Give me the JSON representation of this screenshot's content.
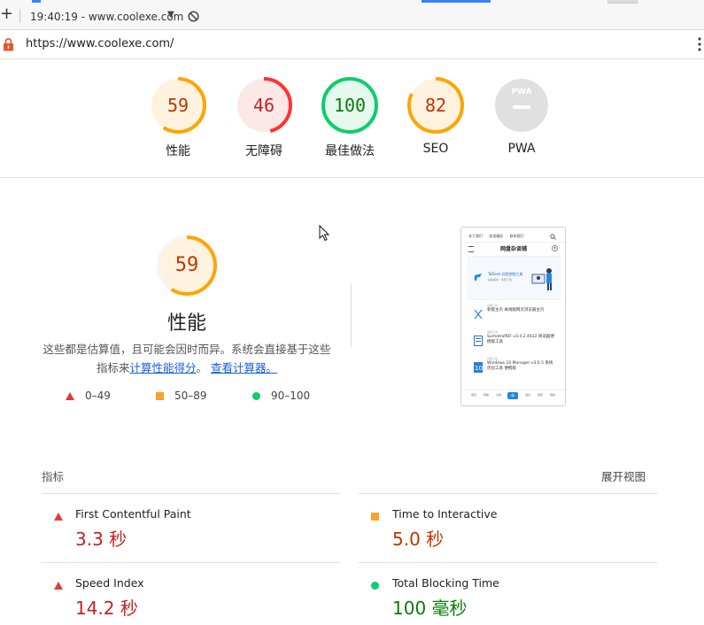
{
  "browser": {
    "tab_time_url": "19:40:19 - www.coolexe.com",
    "address": "https://www.coolexe.com/"
  },
  "categories": [
    {
      "label": "性能",
      "score": "59",
      "fraction": 0.59,
      "color": "#ffa400",
      "bg": "#fff3e0",
      "text_color": "#c33300"
    },
    {
      "label": "无障碍",
      "score": "46",
      "fraction": 0.46,
      "color": "#ff3333",
      "bg": "#fde8e8",
      "text_color": "#c5221f"
    },
    {
      "label": "最佳做法",
      "score": "100",
      "fraction": 1.0,
      "color": "#0cce6b",
      "bg": "#e6f9ee",
      "text_color": "#0a7a0a"
    },
    {
      "label": "SEO",
      "score": "82",
      "fraction": 0.82,
      "color": "#ffa400",
      "bg": "#fff3e0",
      "text_color": "#c33300"
    },
    {
      "label": "PWA",
      "score": "",
      "fraction": 0,
      "color": "#bdbdbd",
      "bg": "#e0e0e0",
      "text_color": "#9e9e9e"
    }
  ],
  "performance": {
    "score": "59",
    "fraction": 0.59,
    "title": "性能",
    "desc_prefix": "这些都是估算值，且可能会因时而异。系统会直接基于这些指标来",
    "link_calc_score": "计算性能得分",
    "desc_mid": "。",
    "link_view_calc": "查看计算器。"
  },
  "legend": [
    {
      "range": "0–49",
      "shape": "triangle",
      "color": "#e53935"
    },
    {
      "range": "50–89",
      "shape": "square",
      "color": "#f8a22b"
    },
    {
      "range": "90–100",
      "shape": "circle",
      "color": "#0cce6b"
    }
  ],
  "preview": {
    "tabs": [
      "关于我们",
      "发现精彩",
      "联系我们"
    ],
    "logo": "网盘杂谈铺",
    "hero_title": "ToDesk 远程控制工具",
    "hero_sub": "最新版本 · 免费下载",
    "items": [
      {
        "tag": "系统工具",
        "title": "新版主页 离线版网页浏览器主页"
      },
      {
        "tag": "系统工具",
        "title": "SumatraPDF v3.4.2.4422 阅读器便携版工具"
      },
      {
        "tag": "系统工具",
        "title": "Windows 10 Manager v3.6.5 系统优化工具 便携版"
      }
    ],
    "footer": [
      "首页",
      "导航",
      "分类",
      "+",
      "消息",
      "发现",
      "我的"
    ]
  },
  "metrics": {
    "section_label": "指标",
    "expand_label": "展开视图",
    "items": [
      {
        "name": "First Contentful Paint",
        "value": "3.3 秒",
        "status": "fail"
      },
      {
        "name": "Time to Interactive",
        "value": "5.0 秒",
        "status": "average"
      },
      {
        "name": "Speed Index",
        "value": "14.2 秒",
        "status": "fail"
      },
      {
        "name": "Total Blocking Time",
        "value": "100 毫秒",
        "status": "pass"
      }
    ]
  }
}
